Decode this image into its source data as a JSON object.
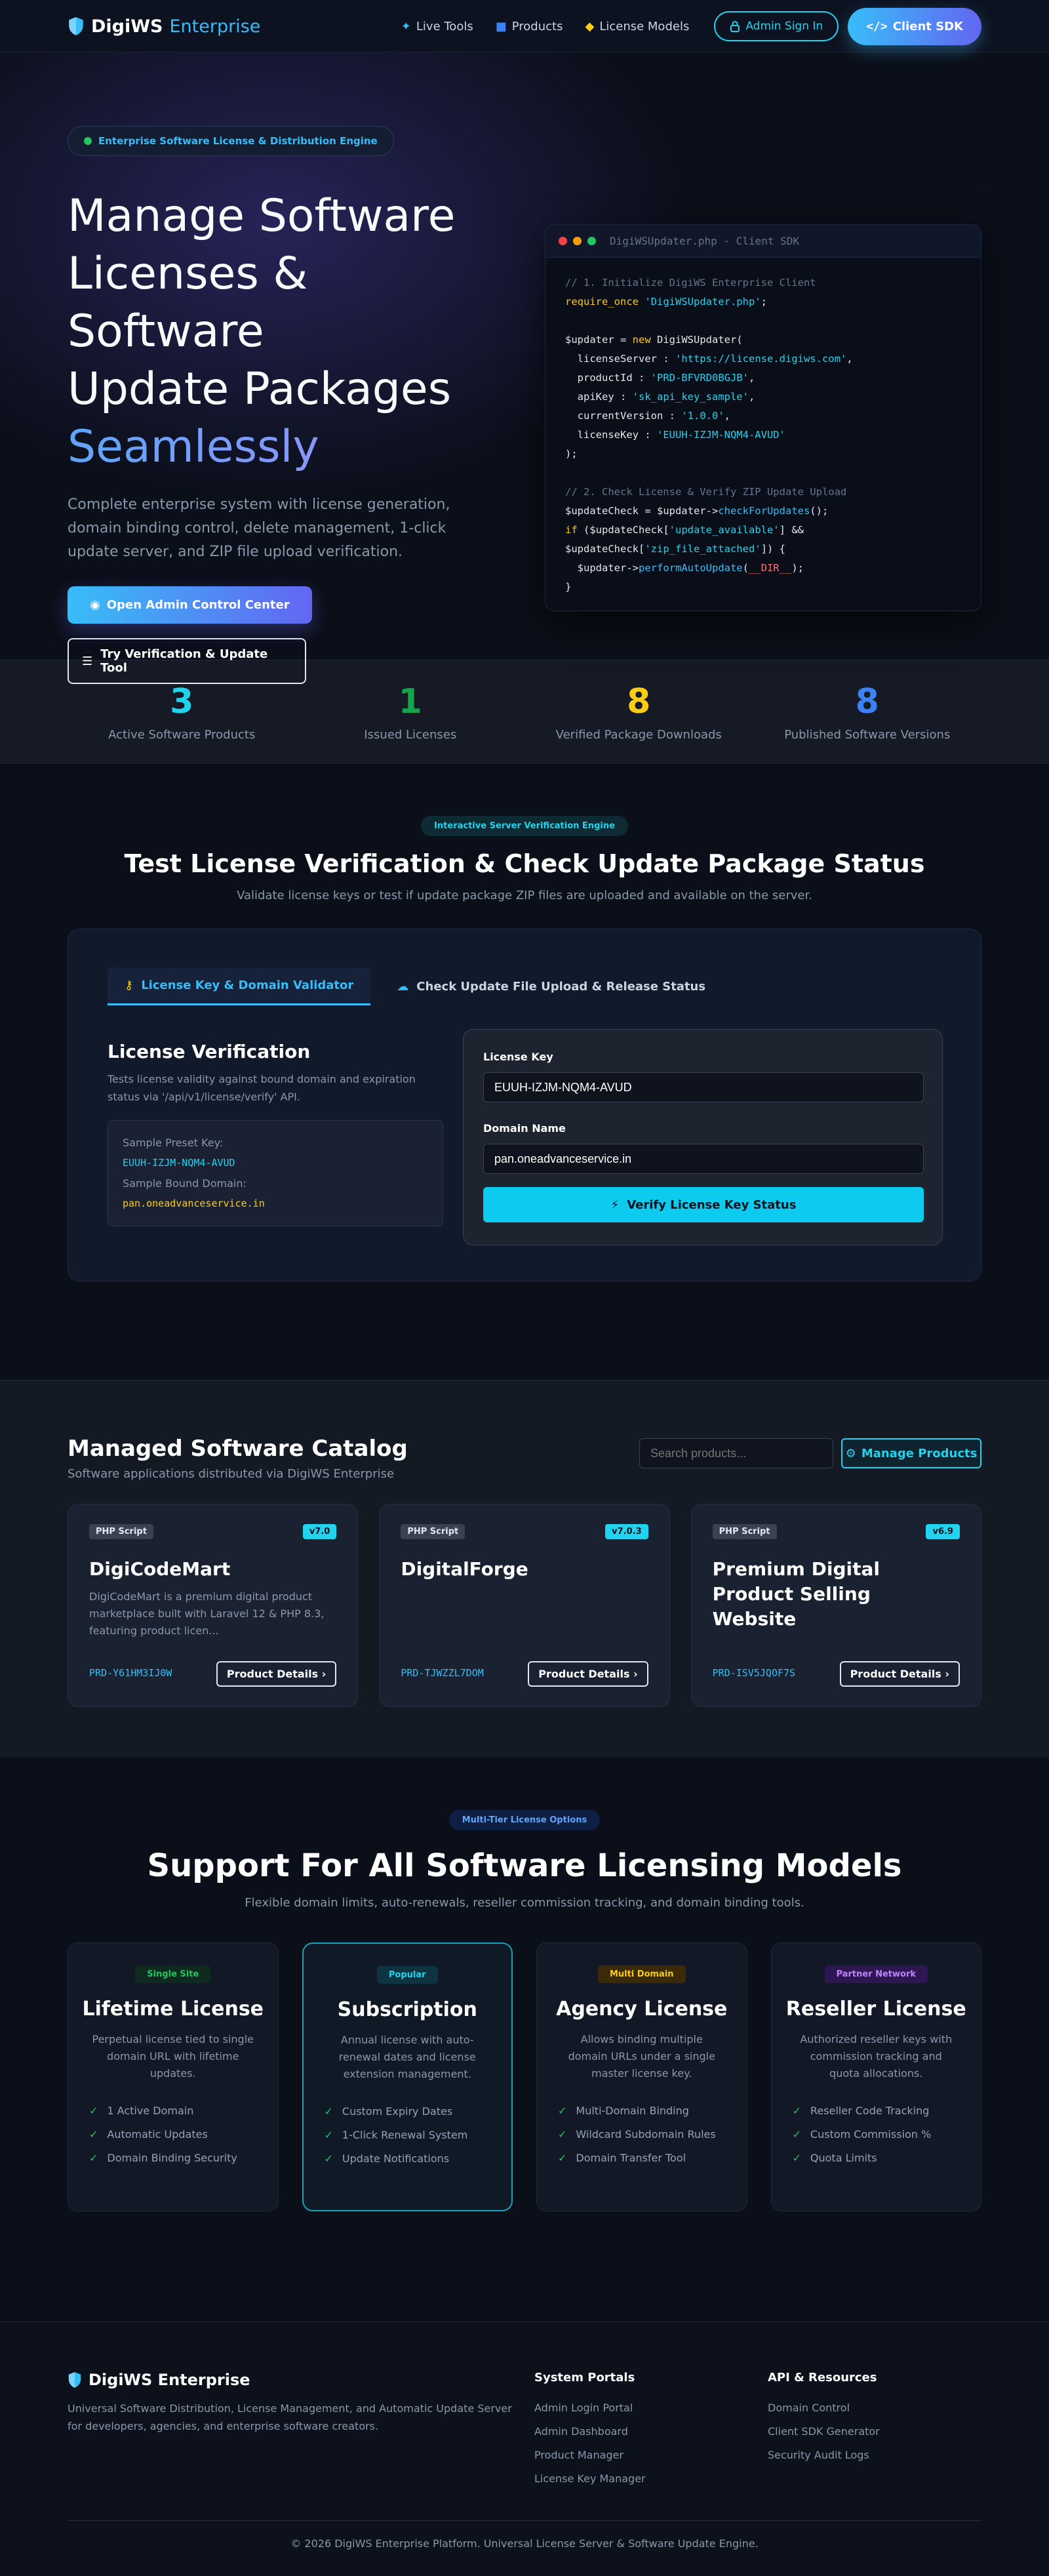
{
  "nav": {
    "brand_main": "DigiWS",
    "brand_sub": "Enterprise",
    "links": [
      {
        "label": "Live Tools",
        "icon": "magic-wand-icon"
      },
      {
        "label": "Products",
        "icon": "box-icon"
      },
      {
        "label": "License Models",
        "icon": "tags-icon"
      }
    ],
    "sign_in": "Admin Sign In",
    "sdk": "Client SDK"
  },
  "hero": {
    "badge": "Enterprise Software License & Distribution Engine",
    "title_line1": "Manage Software",
    "title_line2": "Licenses & Software",
    "title_line3": "Update Packages",
    "title_accent": "Seamlessly",
    "description": "Complete enterprise system with license generation, domain binding control, delete management, 1-click update server, and ZIP file upload verification.",
    "cta_primary": "Open Admin Control Center",
    "cta_secondary": "Try Verification & Update Tool"
  },
  "code": {
    "window_title": "DigiWSUpdater.php - Client SDK",
    "comment1": "// 1. Initialize DigiWS Enterprise Client",
    "require_kw": "require_once",
    "require_file": "'DigiWSUpdater.php'",
    "var_updater": "$updater",
    "new_kw": "new",
    "class_name": "DigiWSUpdater(",
    "license_server_key": "licenseServer",
    "license_server_val": "'https://license.digiws.com'",
    "product_id_key": "productId",
    "product_id_val": "'PRD-BFVRD0BGJB'",
    "api_key_key": "apiKey",
    "api_key_val": "'sk_api_key_sample'",
    "current_version_key": "currentVersion",
    "current_version_val": "'1.0.0'",
    "license_key_key": "licenseKey",
    "license_key_val": "'EUUH-IZJM-NQM4-AVUD'",
    "close_paren": ");",
    "comment2": "// 2. Check License & Verify ZIP Update Upload",
    "var_check": "$updateCheck",
    "check_fn": "checkForUpdates",
    "if_kw": "if",
    "update_available": "'update_available'",
    "zip_attached": "'zip_file_attached'",
    "perform_fn": "performAutoUpdate",
    "dir_const": "__DIR__",
    "close_brace": "}"
  },
  "stats": [
    {
      "value": "3",
      "label": "Active Software Products",
      "color": "#22d3ee"
    },
    {
      "value": "1",
      "label": "Issued Licenses",
      "color": "#16a34a"
    },
    {
      "value": "8",
      "label": "Verified Package Downloads",
      "color": "#facc15"
    },
    {
      "value": "8",
      "label": "Published Software Versions",
      "color": "#3b82f6"
    }
  ],
  "verify": {
    "pill": "Interactive Server Verification Engine",
    "title": "Test License Verification & Check Update Package Status",
    "subtitle": "Validate license keys or test if update package ZIP files are uploaded and available on the server.",
    "tab1": "License Key & Domain Validator",
    "tab2": "Check Update File Upload & Release Status",
    "heading": "License Verification",
    "description": "Tests license validity against bound domain and expiration status via '/api/v1/license/verify' API.",
    "preset_key_label": "Sample Preset Key:",
    "preset_key": "EUUH-IZJM-NQM4-AVUD",
    "preset_domain_label": "Sample Bound Domain:",
    "preset_domain": "pan.oneadvanceservice.in",
    "license_key_label": "License Key",
    "license_key_value": "EUUH-IZJM-NQM4-AVUD",
    "domain_label": "Domain Name",
    "domain_value": "pan.oneadvanceservice.in",
    "verify_button": "Verify License Key Status"
  },
  "catalog": {
    "title": "Managed Software Catalog",
    "subtitle": "Software applications distributed via DigiWS Enterprise",
    "search_placeholder": "Search products...",
    "manage_button": "Manage Products",
    "products": [
      {
        "tag": "PHP Script",
        "version": "v7.0",
        "name": "DigiCodeMart",
        "description": "DigiCodeMart is a premium digital product marketplace built with Laravel 12 & PHP 8.3, featuring product licen...",
        "id": "PRD-Y61HM3IJ0W",
        "button": "Product Details"
      },
      {
        "tag": "PHP Script",
        "version": "v7.0.3",
        "name": "DigitalForge",
        "description": "",
        "id": "PRD-TJWZZL7DOM",
        "button": "Product Details"
      },
      {
        "tag": "PHP Script",
        "version": "v6.9",
        "name": "Premium Digital Product Selling Website",
        "description": "",
        "id": "PRD-ISV5JQOF7S",
        "button": "Product Details"
      }
    ]
  },
  "models": {
    "pill": "Multi-Tier License Options",
    "title": "Support For All Software Licensing Models",
    "subtitle": "Flexible domain limits, auto-renewals, reseller commission tracking, and domain binding tools.",
    "plans": [
      {
        "pill": "Single Site",
        "pill_bg": "#0f2a1f",
        "pill_fg": "#22c55e",
        "name": "Lifetime License",
        "description": "Perpetual license tied to single domain URL with lifetime updates.",
        "features": [
          "1 Active Domain",
          "Automatic Updates",
          "Domain Binding Security"
        ]
      },
      {
        "pill": "Popular",
        "pill_bg": "#0d3440",
        "pill_fg": "#22d3ee",
        "name": "Subscription",
        "description": "Annual license with auto-renewal dates and license extension management.",
        "features": [
          "Custom Expiry Dates",
          "1-Click Renewal System",
          "Update Notifications"
        ]
      },
      {
        "pill": "Multi Domain",
        "pill_bg": "#3a2a08",
        "pill_fg": "#facc15",
        "name": "Agency License",
        "description": "Allows binding multiple domain URLs under a single master license key.",
        "features": [
          "Multi-Domain Binding",
          "Wildcard Subdomain Rules",
          "Domain Transfer Tool"
        ]
      },
      {
        "pill": "Partner Network",
        "pill_bg": "#2e1652",
        "pill_fg": "#c084fc",
        "name": "Reseller License",
        "description": "Authorized reseller keys with commission tracking and quota allocations.",
        "features": [
          "Reseller Code Tracking",
          "Custom Commission %",
          "Quota Limits"
        ]
      }
    ]
  },
  "footer": {
    "brand": "DigiWS Enterprise",
    "description": "Universal Software Distribution, License Management, and Automatic Update Server for developers, agencies, and enterprise software creators.",
    "col1_title": "System Portals",
    "col1_links": [
      "Admin Login Portal",
      "Admin Dashboard",
      "Product Manager",
      "License Key Manager"
    ],
    "col2_title": "API & Resources",
    "col2_links": [
      "Domain Control",
      "Client SDK Generator",
      "Security Audit Logs"
    ],
    "copyright": "© 2026 DigiWS Enterprise Platform. Universal License Server & Software Update Engine."
  }
}
